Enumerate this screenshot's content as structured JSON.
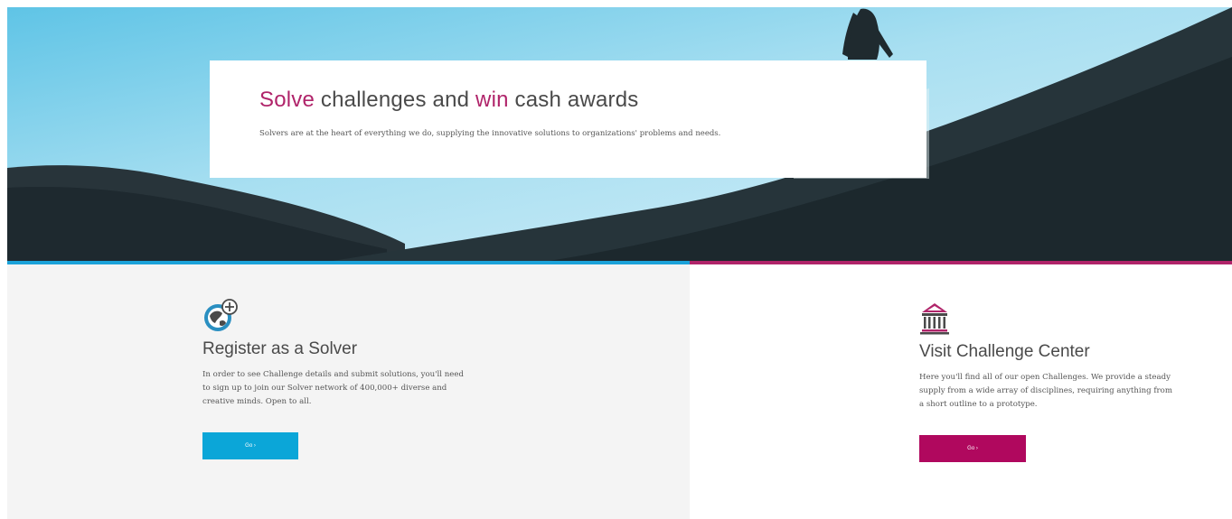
{
  "hero": {
    "title_part1": "Solve",
    "title_part2": " challenges and ",
    "title_part3": "win",
    "title_part4": " cash awards",
    "subtitle": "Solvers are at the heart of everything we do, supplying the innovative solutions to organizations' problems and needs."
  },
  "register": {
    "icon": "globe-plus-icon",
    "title": "Register as a Solver",
    "text": "In order to see Challenge details and submit solutions, you'll need to sign up to join our Solver network of 400,000+ diverse and creative minds. Open to all.",
    "button_label": "Go ›"
  },
  "challenge_center": {
    "icon": "bank-building-icon",
    "title": "Visit Challenge Center",
    "text": "Here you'll find all of our open Challenges. We provide a steady supply from a wide array of disciplines, requiring anything from a short outline to a prototype.",
    "button_label": "Go ›"
  },
  "colors": {
    "accent_pink": "#b0246a",
    "accent_blue": "#1ba2d9",
    "button_blue": "#0ba6d8",
    "button_pink": "#b0085e"
  }
}
